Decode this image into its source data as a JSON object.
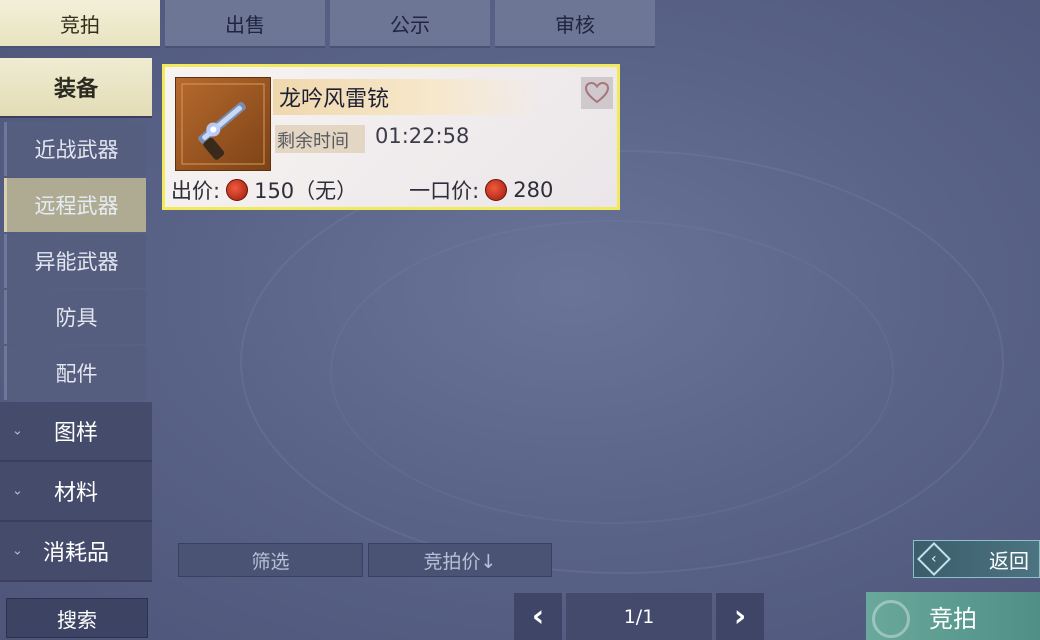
{
  "tabs": [
    {
      "label": "竞拍",
      "active": true
    },
    {
      "label": "出售",
      "active": false
    },
    {
      "label": "公示",
      "active": false
    },
    {
      "label": "审核",
      "active": false
    }
  ],
  "sidebar": {
    "active_category": "装备",
    "subcategories": [
      "近战武器",
      "远程武器",
      "异能武器",
      "防具",
      "配件"
    ],
    "active_subcategory": "远程武器",
    "collapsed_categories": [
      "图样",
      "材料",
      "消耗品"
    ]
  },
  "item": {
    "name": "龙吟风雷铳",
    "time_label": "剩余时间",
    "time_value": "01:22:58",
    "bid_label": "出价:",
    "bid_value": "150（无）",
    "buyout_label": "一口价:",
    "buyout_value": "280"
  },
  "filters": {
    "filter_label": "筛选",
    "sort_label": "竞拍价↓"
  },
  "back_label": "返回",
  "search_label": "搜索",
  "pagination": {
    "text": "1/1"
  },
  "bid_button_label": "竞拍",
  "colors": {
    "card_border": "#f2ea5a",
    "accent_teal": "#4f8f86",
    "active_tab": "#e8e3c1"
  }
}
